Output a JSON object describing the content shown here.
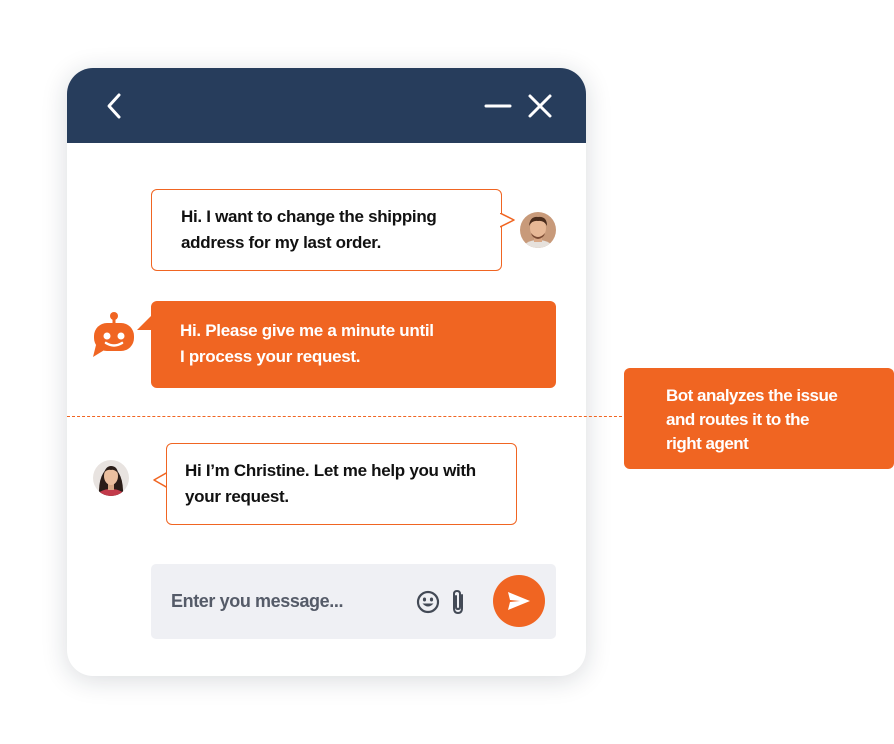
{
  "messages": [
    {
      "sender": "customer",
      "lines": [
        "Hi. I want to change the shipping",
        "address for my last order."
      ]
    },
    {
      "sender": "bot",
      "lines": [
        "Hi. Please give me a minute until",
        "I process your request."
      ]
    },
    {
      "sender": "agent",
      "lines": [
        "Hi I’m Christine. Let me help you with",
        "your request."
      ]
    }
  ],
  "input": {
    "placeholder": "Enter you message..."
  },
  "annotation": {
    "lines": [
      "Bot analyzes the issue",
      "and routes it to the",
      "right agent"
    ]
  },
  "icons": {
    "header": [
      "chevron-left-icon",
      "minimize-icon",
      "close-icon"
    ],
    "input": [
      "emoji-icon",
      "paperclip-icon",
      "send-icon"
    ],
    "bot": "robot-icon"
  },
  "colors": {
    "header_bg": "#273d5c",
    "accent": "#f06522",
    "input_bg": "#eff0f4"
  }
}
